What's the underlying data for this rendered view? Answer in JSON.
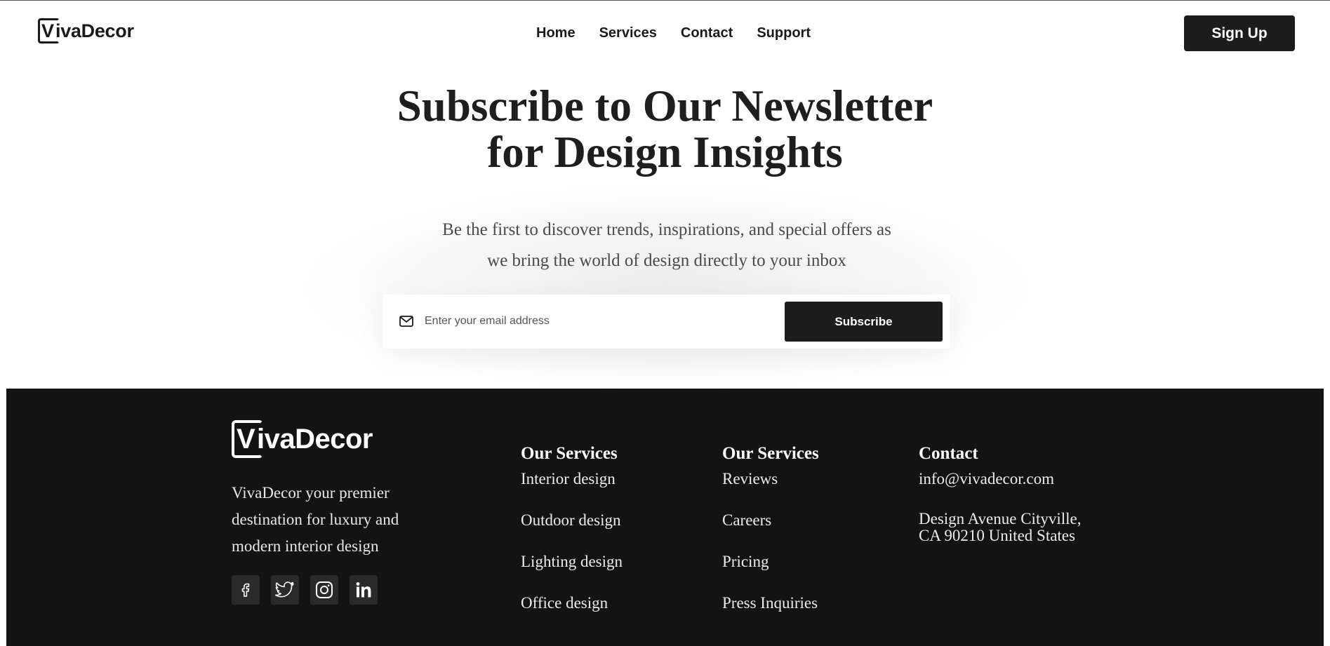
{
  "header": {
    "logo_initial": "V",
    "logo_rest": "ivaDecor",
    "nav": [
      "Home",
      "Services",
      "Contact",
      "Support"
    ],
    "signup_label": "Sign Up"
  },
  "hero": {
    "title_line1": "Subscribe to Our Newsletter",
    "title_line2": "for Design Insights",
    "subtitle_line1": "Be the first to discover trends, inspirations, and special offers as",
    "subtitle_line2": "we bring the world of design directly to your inbox",
    "email_placeholder": "Enter your email address",
    "email_icon": "mail-icon",
    "subscribe_label": "Subscribe"
  },
  "footer": {
    "logo_initial": "V",
    "logo_rest": "ivaDecor",
    "description": "VivaDecor your premier destination for luxury and modern interior design",
    "socials": [
      "facebook-icon",
      "twitter-icon",
      "instagram-icon",
      "linkedin-icon"
    ],
    "services1": {
      "heading": "Our Services",
      "items": [
        "Interior design",
        "Outdoor design",
        "Lighting design",
        "Office design"
      ]
    },
    "services2": {
      "heading": "Our Services",
      "items": [
        "Reviews",
        "Careers",
        "Pricing",
        "Press Inquiries"
      ]
    },
    "contact": {
      "heading": "Contact",
      "email": "info@vivadecor.com",
      "address_line1": "Design Avenue Cityville,",
      "address_line2": "CA 90210 United States"
    }
  },
  "colors": {
    "primary": "#1c1c1c",
    "footer_bg": "#131313",
    "text": "#1a1a1a",
    "subtitle": "#4a4a4a"
  }
}
